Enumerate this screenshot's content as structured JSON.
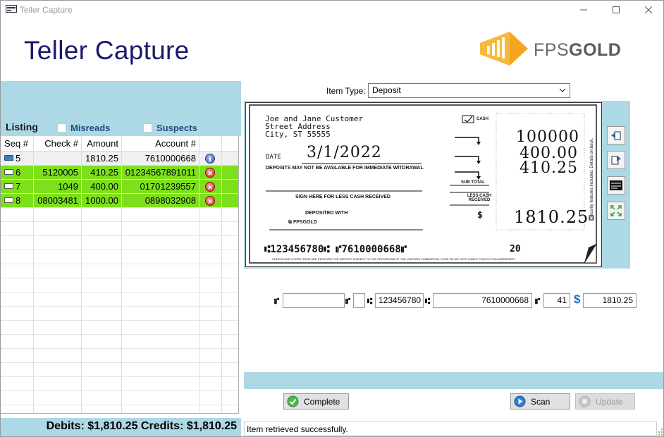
{
  "window": {
    "title": "Teller Capture"
  },
  "header": {
    "app_title": "Teller Capture",
    "logo": {
      "light": "FPS",
      "bold": "GOLD"
    }
  },
  "listing": {
    "label": "Listing",
    "misreads_label": "Misreads",
    "suspects_label": "Suspects",
    "columns": [
      "Seq #",
      "Check #",
      "Amount",
      "Account #"
    ],
    "rows": [
      {
        "seq": "5",
        "check": "",
        "amount": "1810.25",
        "account": "7610000668",
        "status": "info",
        "highlight": false
      },
      {
        "seq": "6",
        "check": "5120005",
        "amount": "410.25",
        "account": "01234567891011",
        "status": "error",
        "highlight": true
      },
      {
        "seq": "7",
        "check": "1049",
        "amount": "400.00",
        "account": "01701239557",
        "status": "error",
        "highlight": true
      },
      {
        "seq": "8",
        "check": "08003481",
        "amount": "1000.00",
        "account": "0898032908",
        "status": "error",
        "highlight": true
      }
    ]
  },
  "totals": {
    "text": "Debits: $1,810.25 Credits: $1,810.25"
  },
  "item_type": {
    "label": "Item Type:",
    "value": "Deposit"
  },
  "check": {
    "name": "Joe and Jane Customer",
    "street": "Street Address",
    "city": "City, ST 55555",
    "date_label": "DATE",
    "date_value": "3/1/2022",
    "notice": "DEPOSITS MAY NOT BE AVAILABLE FOR IMMEDIATE WITDRAWAL",
    "sign_label": "SIGN HERE FOR LESS CASH RECEIVED",
    "deposited_with": "DEPOSITED WITH",
    "fps_mark": "FPSGOLD",
    "cash_label": "CASH",
    "subtotal_label": "SUB TOTAL",
    "less_cash_label": "LESS CASH RECEIVED",
    "dollar": "$",
    "hand_amounts": [
      "100000",
      "400.00",
      "410.25"
    ],
    "hand_total": "1810.25",
    "security_text": "Security features included. Details on back.",
    "micr_line": "⑆123456780⑆ ⑈7610000668⑈",
    "micr_seq": "20",
    "footer_note": "CHECKS AND OTHER ITEMS ARE RECEIVED FOR DEPOSIT SUBJECT TO THE PROVISIONS OF THE UNIFORM COMMERCIAL CODE OR ANY APPLICABLE COLLECTION AGREEMENT"
  },
  "micr_fields": {
    "aux_onus": "",
    "epc": "",
    "routing": "123456780",
    "account": "7610000668",
    "tran_code": "41",
    "amount": "1810.25"
  },
  "buttons": {
    "complete": "Complete",
    "scan": "Scan",
    "update": "Update"
  },
  "status_bar": {
    "message": "Item retrieved successfully."
  },
  "colors": {
    "accent_band": "#add8e6",
    "highlight_row": "#7ee01c",
    "title_navy": "#1a1a6b"
  }
}
